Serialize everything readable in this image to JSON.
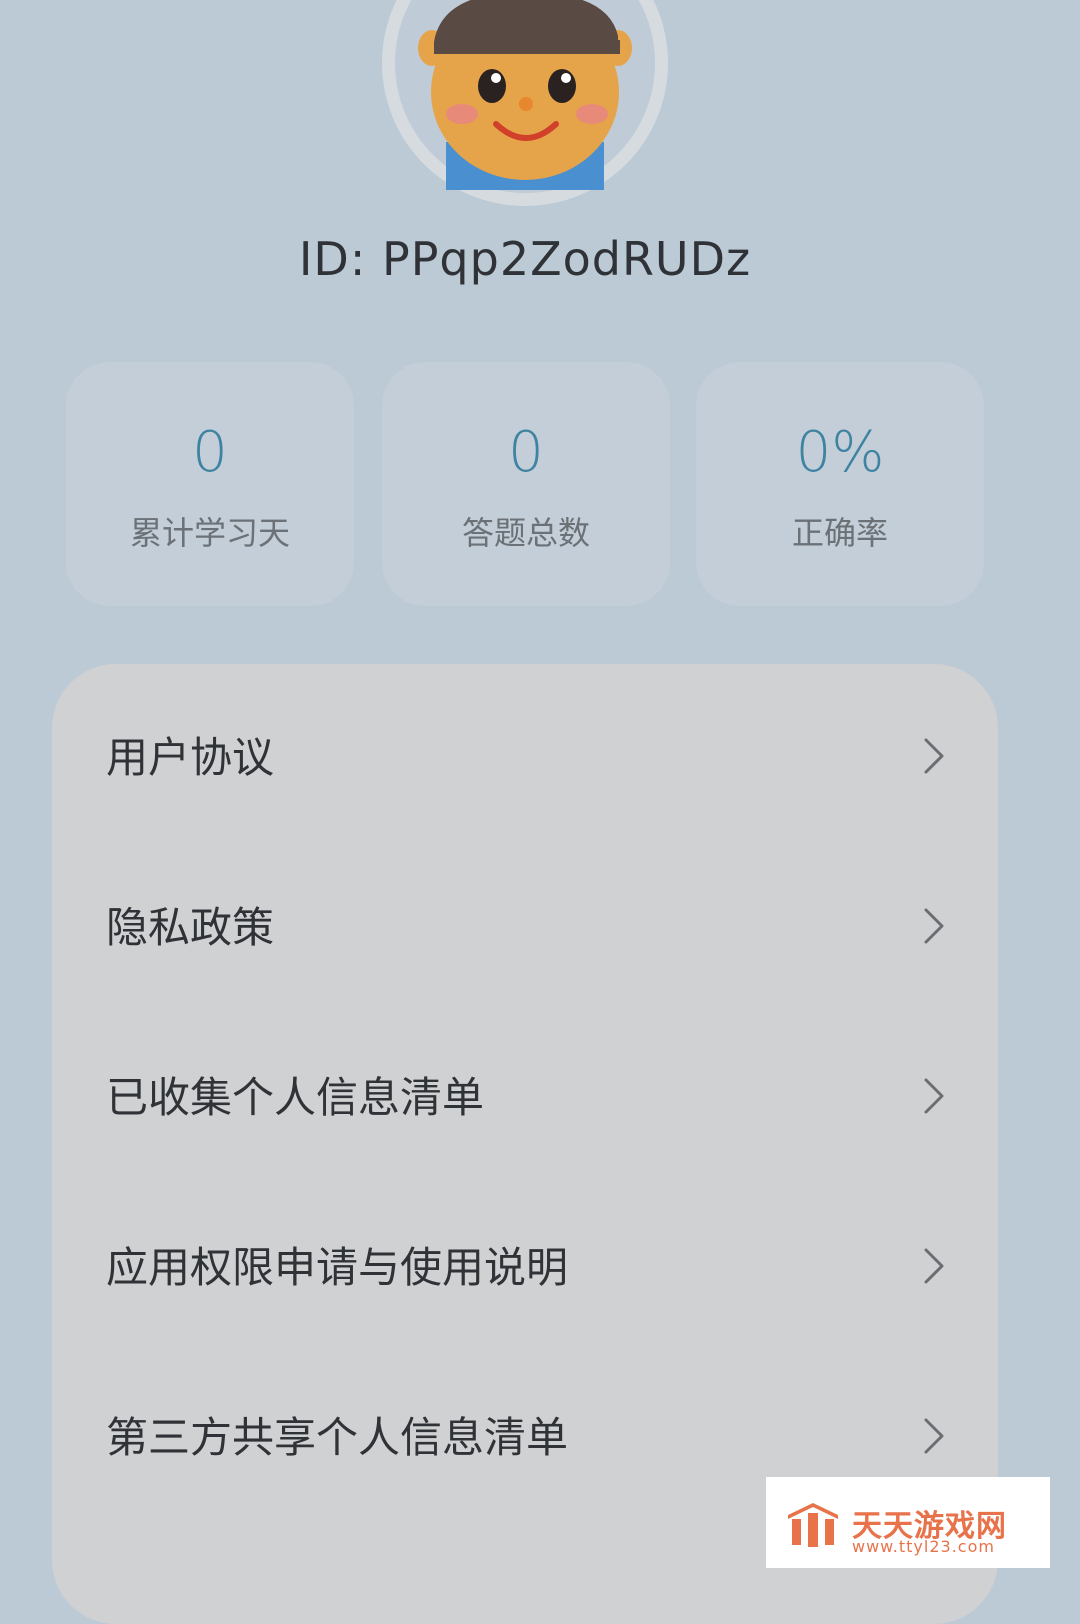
{
  "profile": {
    "id_text": "ID:  PPqp2ZodRUDz"
  },
  "stats": [
    {
      "value": "0",
      "label": "累计学习天"
    },
    {
      "value": "0",
      "label": "答题总数"
    },
    {
      "value": "0%",
      "label": "正确率"
    }
  ],
  "menu": {
    "items": [
      {
        "label": "用户协议"
      },
      {
        "label": "隐私政策"
      },
      {
        "label": "已收集个人信息清单"
      },
      {
        "label": "应用权限申请与使用说明"
      },
      {
        "label": "第三方共享个人信息清单"
      }
    ]
  },
  "watermark": {
    "name": "天天游戏网",
    "url": "www.ttyl23.com"
  },
  "colors": {
    "background": "#bccad6",
    "stat_value": "#3e83a2",
    "watermark_orange": "#e8734a"
  },
  "icons": {
    "avatar": "cartoon-boy-avatar-icon",
    "chevron": "chevron-right-icon",
    "watermark_logo": "watermark-logo-icon"
  }
}
